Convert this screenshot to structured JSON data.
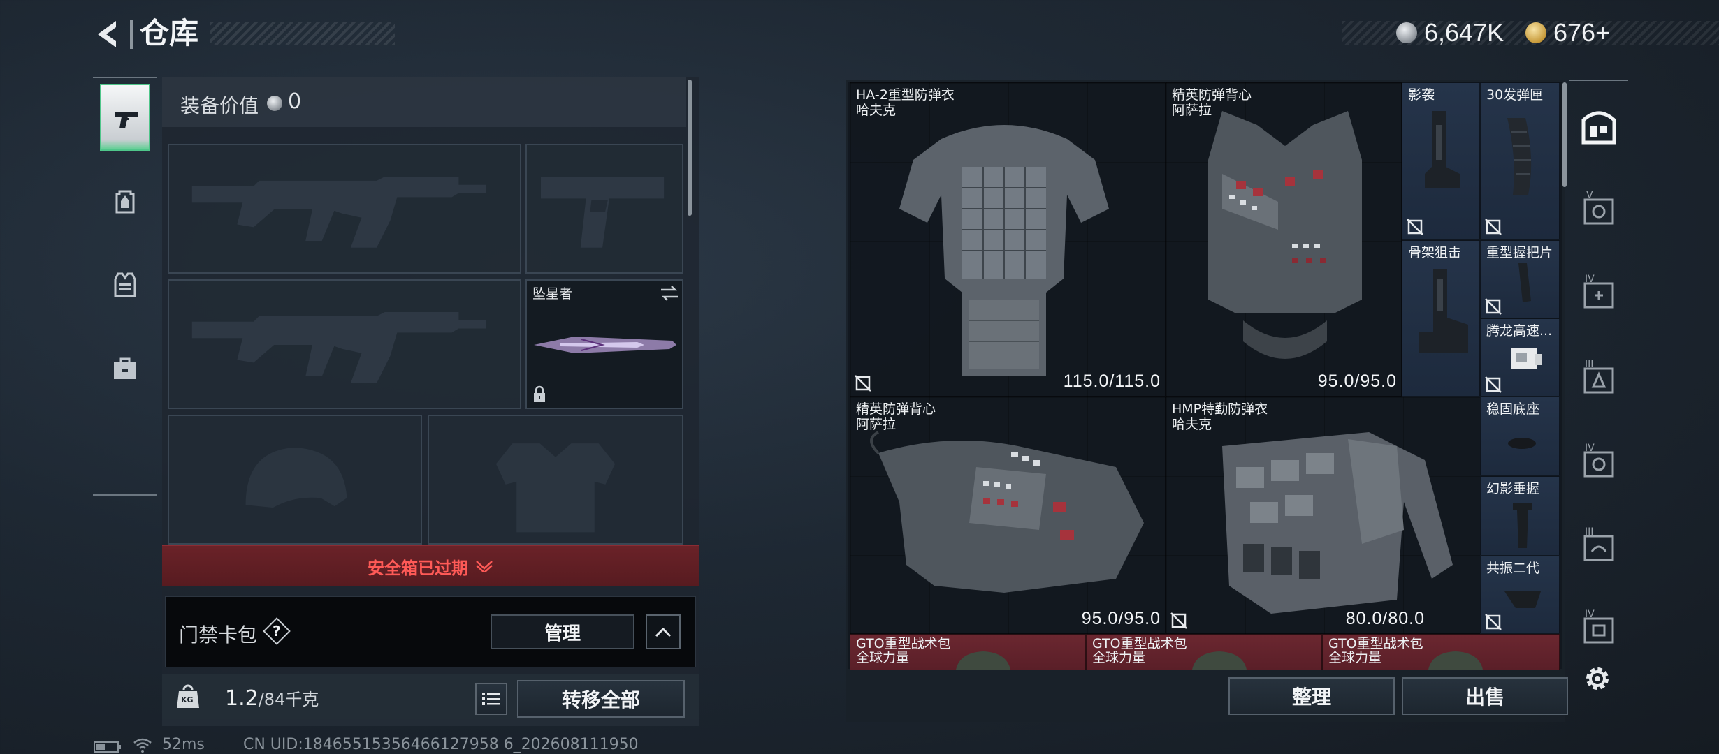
{
  "header": {
    "title": "仓库",
    "currency": [
      {
        "icon": "silver-coin-icon",
        "value": "6,647K"
      },
      {
        "icon": "gold-coin-icon",
        "value": "676+"
      }
    ]
  },
  "left_tabs": [
    {
      "icon": "pistol-icon",
      "active": true
    },
    {
      "icon": "backpack-icon",
      "active": false
    },
    {
      "icon": "vest-icon",
      "active": false
    },
    {
      "icon": "toolbox-icon",
      "active": false
    }
  ],
  "loadout": {
    "equip_value_label": "装备价值",
    "equip_value": "0",
    "melee_name": "坠星者",
    "safe_box_status": "安全箱已过期",
    "card_bag_label": "门禁卡包",
    "help_symbol": "?",
    "manage_label": "管理",
    "weight_current": "1.2",
    "weight_max": "/84千克",
    "kg_badge": "KG",
    "transfer_all_label": "转移全部"
  },
  "inventory": {
    "items": [
      {
        "name": "HA-2重型防弹衣",
        "sub": "哈夫克",
        "durability": "115.0/115.0",
        "bg": "red"
      },
      {
        "name": "精英防弹背心",
        "sub": "阿萨拉",
        "durability": "95.0/95.0",
        "bg": "brown"
      },
      {
        "name": "影袭",
        "sub": "",
        "durability": "",
        "bg": "navy"
      },
      {
        "name": "30发弹匣",
        "sub": "",
        "durability": "",
        "bg": "navy"
      },
      {
        "name": "骨架狙击",
        "sub": "",
        "durability": "",
        "bg": "navy"
      },
      {
        "name": "重型握把片",
        "sub": "",
        "durability": "",
        "bg": "navy"
      },
      {
        "name": "腾龙高速...",
        "sub": "",
        "durability": "",
        "bg": "navy"
      },
      {
        "name": "精英防弹背心",
        "sub": "阿萨拉",
        "durability": "95.0/95.0",
        "bg": "brown"
      },
      {
        "name": "HMP特勤防弹衣",
        "sub": "哈夫克",
        "durability": "80.0/80.0",
        "bg": "slate"
      },
      {
        "name": "稳固底座",
        "sub": "",
        "durability": "",
        "bg": "navy"
      },
      {
        "name": "幻影垂握",
        "sub": "",
        "durability": "",
        "bg": "navy"
      },
      {
        "name": "共振二代",
        "sub": "",
        "durability": "",
        "bg": "navy"
      },
      {
        "name": "GTO重型战术包",
        "sub": "全球力量",
        "durability": "",
        "bg": "red"
      },
      {
        "name": "GTO重型战术包",
        "sub": "全球力量",
        "durability": "",
        "bg": "red"
      },
      {
        "name": "GTO重型战术包",
        "sub": "全球力量",
        "durability": "",
        "bg": "red"
      }
    ],
    "sort_label": "整理",
    "sell_label": "出售"
  },
  "right_rail": [
    {
      "icon": "warehouse-icon"
    },
    {
      "icon": "storage-v-icon"
    },
    {
      "icon": "storage-iv-plus-icon"
    },
    {
      "icon": "storage-iii-icon"
    },
    {
      "icon": "storage-iv-icon"
    },
    {
      "icon": "storage-iii-alt-icon"
    },
    {
      "icon": "storage-iv-alt-icon"
    },
    {
      "icon": "gear-icon"
    }
  ],
  "status_bar": {
    "ping": "52ms",
    "uid": "CN UID:18465515356466127958 6_202608111950"
  }
}
